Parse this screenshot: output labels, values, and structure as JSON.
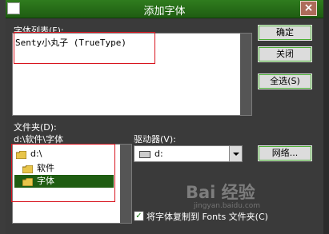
{
  "window": {
    "title": "添加字体",
    "close_glyph": "×"
  },
  "font_list": {
    "label": "字体列表(F):",
    "items": [
      "Senty小丸子 (TrueType)"
    ]
  },
  "buttons": {
    "ok": "确定",
    "close": "关闭",
    "select_all": "全选(S)",
    "network": "网络..."
  },
  "folders": {
    "label": "文件夹(D):",
    "current_path": "d:\\软件\\字体",
    "items": [
      {
        "label": "d:\\",
        "selected": false
      },
      {
        "label": "软件",
        "selected": false
      },
      {
        "label": "字体",
        "selected": true
      }
    ]
  },
  "drives": {
    "label": "驱动器(V):",
    "selected": "d:"
  },
  "copy_option": {
    "label": "将字体复制到 Fonts 文件夹(C)",
    "checked": true
  },
  "watermark": {
    "text": "Bai 经验",
    "sub": "jingyan.baidu.com"
  },
  "colors": {
    "titlebar": "#2f7c1e",
    "dialog_bg": "#3a3a3a",
    "selection": "#1f5d12",
    "annotation_red": "#d8141e"
  }
}
